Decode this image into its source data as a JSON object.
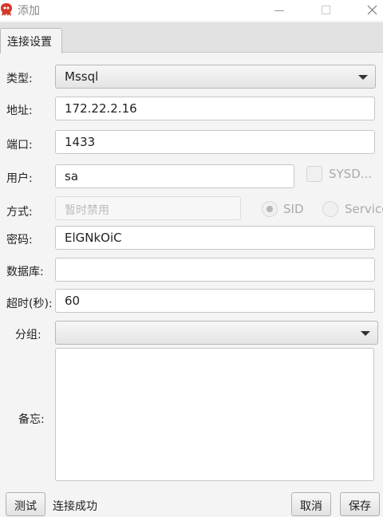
{
  "window": {
    "title": "添加",
    "icons": {
      "app": "app-logo-icon",
      "minimize": "minimize-icon",
      "maximize": "maximize-icon",
      "close": "close-icon"
    }
  },
  "tabs": [
    {
      "label": "连接设置"
    }
  ],
  "form": {
    "type": {
      "label": "类型:",
      "value": "Mssql"
    },
    "address": {
      "label": "地址:",
      "value": "172.22.2.16"
    },
    "port": {
      "label": "端口:",
      "value": "1433"
    },
    "user": {
      "label": "用户:",
      "value": "sa",
      "sysdba_label": "SYSD..."
    },
    "mode": {
      "label": "方式:",
      "placeholder": "暂时禁用",
      "sid_label": "SID",
      "service_label": "Service"
    },
    "password": {
      "label": "密码:",
      "value": "ElGNkOiC"
    },
    "database": {
      "label": "数据库:",
      "value": ""
    },
    "timeout": {
      "label": "超时(秒):",
      "value": "60"
    },
    "group": {
      "label": "分组:",
      "value": ""
    },
    "notes": {
      "label": "备忘:",
      "value": ""
    }
  },
  "footer": {
    "test_label": "测试",
    "status_text": "连接成功",
    "cancel_label": "取消",
    "save_label": "保存"
  }
}
